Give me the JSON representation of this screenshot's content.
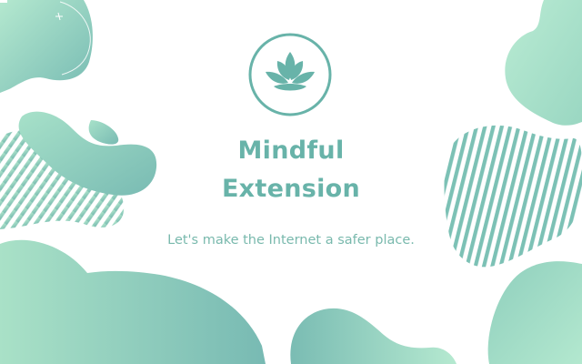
{
  "brand": {
    "title_line_1": "Mindful",
    "title_line_2": "Extension",
    "tagline": "Let's make the Internet a safer place.",
    "logo_icon": "lotus-icon"
  },
  "colors": {
    "background": "#ffffff",
    "primary": "#68b3a9",
    "tagline": "#79b9ad",
    "blob_light": "#b0e7cd",
    "blob_dark": "#79bcb4"
  }
}
